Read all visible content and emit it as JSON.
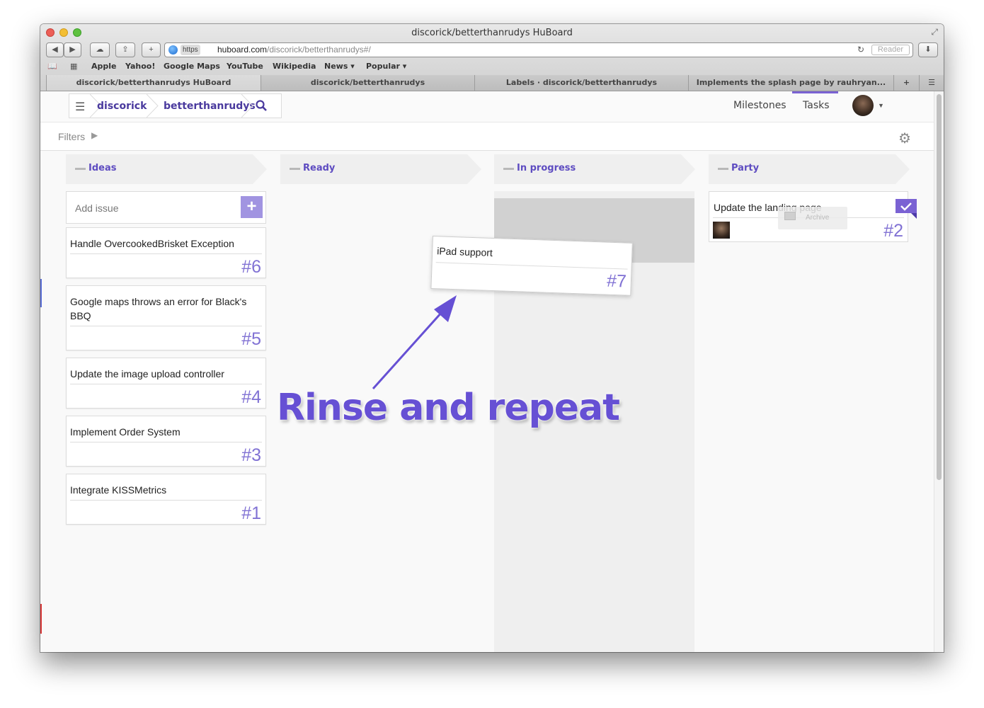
{
  "window": {
    "title": "discorick/betterthanrudys HuBoard"
  },
  "toolbar": {
    "url_scheme": "https",
    "url_host": "huboard.com",
    "url_path": "/discorick/betterthanrudys#/",
    "reader_label": "Reader"
  },
  "bookmarks": [
    "Apple",
    "Yahoo!",
    "Google Maps",
    "YouTube",
    "Wikipedia",
    "News ▾",
    "Popular ▾"
  ],
  "tabs": [
    {
      "label": "discorick/betterthanrudys HuBoard"
    },
    {
      "label": "discorick/betterthanrudys"
    },
    {
      "label": "Labels · discorick/betterthanrudys"
    },
    {
      "label": "Implements the splash page by rauhryan..."
    }
  ],
  "nav": {
    "user": "discorick",
    "repo": "betterthanrudys",
    "milestones_label": "Milestones",
    "tasks_label": "Tasks"
  },
  "filters": {
    "label": "Filters"
  },
  "columns": [
    {
      "label": "Ideas"
    },
    {
      "label": "Ready"
    },
    {
      "label": "In progress"
    },
    {
      "label": "Party"
    }
  ],
  "add_issue": {
    "placeholder": "Add issue",
    "plus_label": "+"
  },
  "ideas_cards": [
    {
      "title": "Handle OvercookedBrisket Exception",
      "number": "#6"
    },
    {
      "title": "Google maps throws an error for Black's BBQ",
      "number": "#5"
    },
    {
      "title": "Update the image upload controller",
      "number": "#4"
    },
    {
      "title": "Implement Order System",
      "number": "#3"
    },
    {
      "title": "Integrate KISSMetrics",
      "number": "#1"
    }
  ],
  "dragged_card": {
    "title": "iPad support",
    "number": "#7"
  },
  "party_card": {
    "title": "Update the landing page",
    "number": "#2",
    "archive_label": "Archive"
  },
  "annotation": {
    "text": "Rinse and repeat"
  },
  "colors": {
    "accent": "#6650d4",
    "label_purple": "#5e4cc1",
    "number_purple": "#8172d4"
  }
}
